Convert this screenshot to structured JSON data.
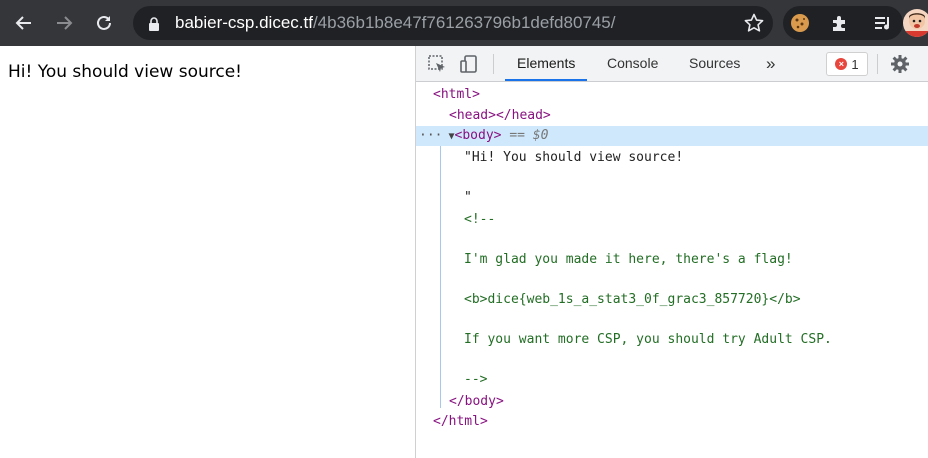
{
  "browser": {
    "url_host": "babier-csp.dicec.tf",
    "url_path": "/4b36b1b8e47f761263796b1defd80745/",
    "nav_icons": [
      "back-arrow-icon",
      "forward-arrow-icon",
      "reload-icon"
    ]
  },
  "page": {
    "text": "Hi! You should view source!"
  },
  "devtools": {
    "tabs": [
      "Elements",
      "Console",
      "Sources"
    ],
    "active_tab": "Elements",
    "more_tabs": "»",
    "error_count": "1",
    "tree": {
      "html_open": "<html>",
      "head": "<head></head>",
      "body_open": "<body>",
      "body_eq": "== $0",
      "text_line1": "\"Hi! You should view source!",
      "text_line2": "\"",
      "comment_open": "<!--",
      "comment_line1": "I'm glad you made it here, there's a flag!",
      "comment_line2": "<b>dice{web_1s_a_stat3_0f_grac3_857720}</b>",
      "comment_line3": "If you want more CSP, you should try Adult CSP.",
      "comment_close": "-->",
      "body_close": "</body>",
      "html_close": "</html>"
    }
  }
}
